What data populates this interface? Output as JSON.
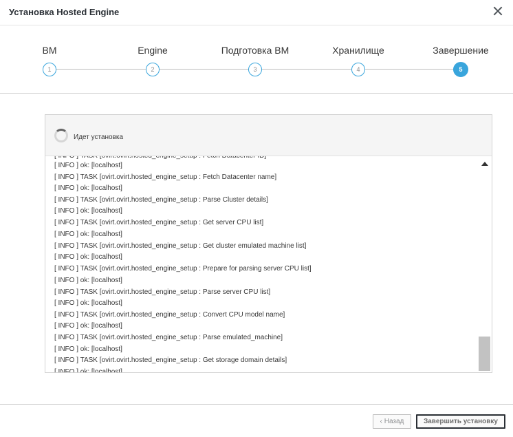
{
  "dialog": {
    "title": "Установка Hosted Engine"
  },
  "wizard": {
    "steps": [
      {
        "label": "ВМ",
        "number": "1",
        "active": false
      },
      {
        "label": "Engine",
        "number": "2",
        "active": false
      },
      {
        "label": "Подготовка ВМ",
        "number": "3",
        "active": false
      },
      {
        "label": "Хранилище",
        "number": "4",
        "active": false
      },
      {
        "label": "Завершение",
        "number": "5",
        "active": true
      }
    ]
  },
  "progress": {
    "status_text": "Идет установка"
  },
  "log": {
    "top_partial": "[ INFO ] TASK [ovirt.ovirt.hosted_engine_setup : Fetch Datacenter ID]",
    "lines": [
      "[ INFO ] ok: [localhost]",
      "[ INFO ] TASK [ovirt.ovirt.hosted_engine_setup : Fetch Datacenter name]",
      "[ INFO ] ok: [localhost]",
      "[ INFO ] TASK [ovirt.ovirt.hosted_engine_setup : Parse Cluster details]",
      "[ INFO ] ok: [localhost]",
      "[ INFO ] TASK [ovirt.ovirt.hosted_engine_setup : Get server CPU list]",
      "[ INFO ] ok: [localhost]",
      "[ INFO ] TASK [ovirt.ovirt.hosted_engine_setup : Get cluster emulated machine list]",
      "[ INFO ] ok: [localhost]",
      "[ INFO ] TASK [ovirt.ovirt.hosted_engine_setup : Prepare for parsing server CPU list]",
      "[ INFO ] ok: [localhost]",
      "[ INFO ] TASK [ovirt.ovirt.hosted_engine_setup : Parse server CPU list]",
      "[ INFO ] ok: [localhost]",
      "[ INFO ] TASK [ovirt.ovirt.hosted_engine_setup : Convert CPU model name]",
      "[ INFO ] ok: [localhost]",
      "[ INFO ] TASK [ovirt.ovirt.hosted_engine_setup : Parse emulated_machine]",
      "[ INFO ] ok: [localhost]",
      "[ INFO ] TASK [ovirt.ovirt.hosted_engine_setup : Get storage domain details]"
    ],
    "bottom_partial": "[ INFO ] ok: [localhost]"
  },
  "footer": {
    "back_label": "‹ Назад",
    "finish_label": "Завершить установку"
  },
  "colors": {
    "accent": "#39a5dc",
    "text": "#363636"
  }
}
